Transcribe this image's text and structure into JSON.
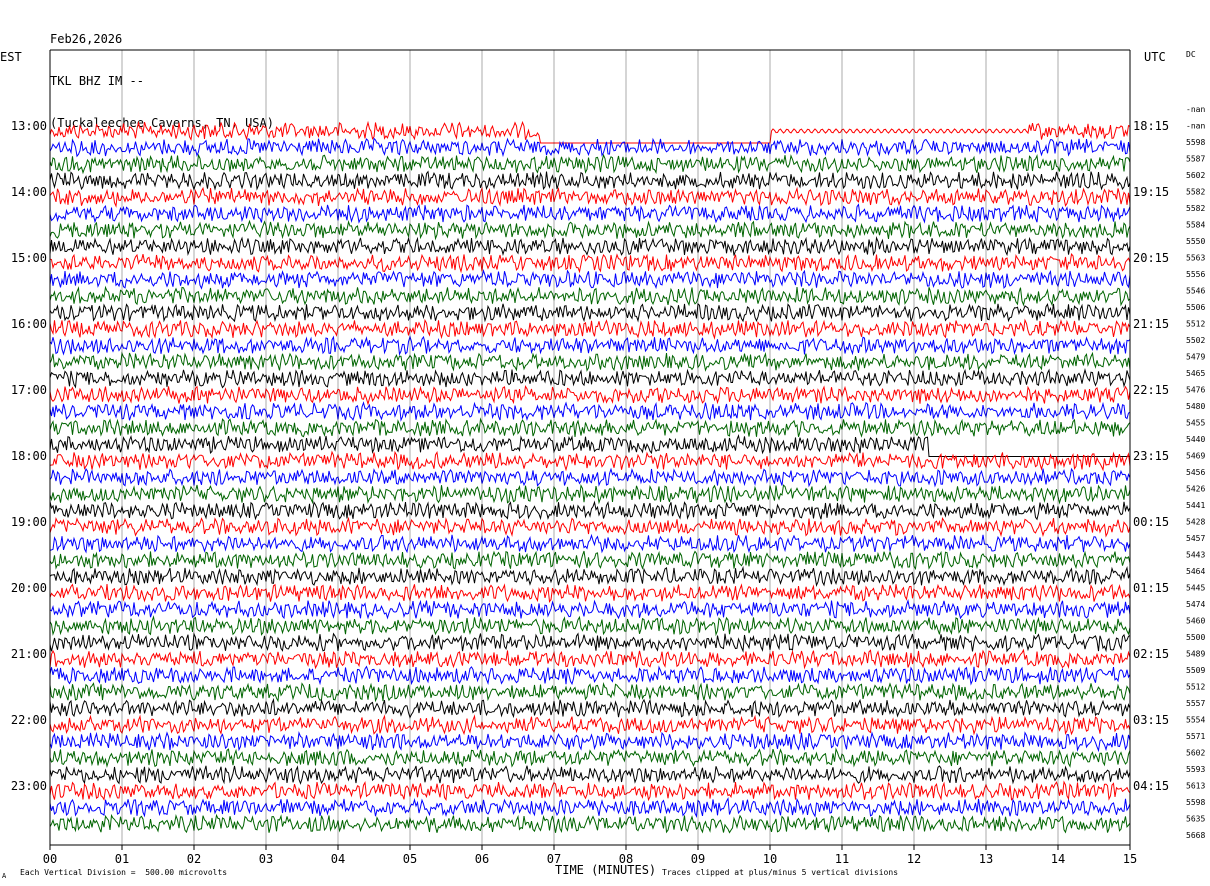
{
  "header": {
    "date": "Feb26,2026",
    "station": "TKL BHZ IM --",
    "location": "(Tuckaleechee Caverns, TN, USA)"
  },
  "left_axis_label": "EST",
  "right_axis_label": "UTC",
  "dc_label": "DC",
  "footer": {
    "x_title": "TIME (MINUTES)",
    "scale_note": "Each Vertical Division =  500.00 microvolts",
    "clip_note": "Traces clipped at plus/minus 5 vertical divisions",
    "corner_mark": "A"
  },
  "colors": {
    "trace_cycle": [
      "#ff0000",
      "#0000ff",
      "#006400",
      "#000000"
    ],
    "grid": "#000000"
  },
  "chart_data": {
    "type": "line",
    "title": "",
    "xlabel": "TIME (MINUTES)",
    "xlim": [
      0,
      15
    ],
    "x_ticks": [
      "00",
      "01",
      "02",
      "03",
      "04",
      "05",
      "06",
      "07",
      "08",
      "09",
      "10",
      "11",
      "12",
      "13",
      "14",
      "15"
    ],
    "rows_per_hour": 4,
    "left_hour_labels": [
      "13:00",
      "14:00",
      "15:00",
      "16:00",
      "17:00",
      "18:00",
      "19:00",
      "20:00",
      "21:00",
      "22:00",
      "23:00"
    ],
    "right_hour_labels": [
      "18:15",
      "19:15",
      "20:15",
      "21:15",
      "22:15",
      "23:15",
      "00:15",
      "01:15",
      "02:15",
      "03:15",
      "04:15"
    ],
    "row_values": [
      "-nan",
      "-nan",
      "5598",
      "5587",
      "5602",
      "5582",
      "5582",
      "5584",
      "5550",
      "5563",
      "5556",
      "5546",
      "5506",
      "5512",
      "5502",
      "5479",
      "5465",
      "5476",
      "5480",
      "5455",
      "5440",
      "5469",
      "5456",
      "5426",
      "5441",
      "5428",
      "5457",
      "5443",
      "5464",
      "5445",
      "5474",
      "5460",
      "5500",
      "5489",
      "5509",
      "5512",
      "5557",
      "5554",
      "5571",
      "5602",
      "5593",
      "5613",
      "5598",
      "5635",
      "5668"
    ],
    "trace_start_minute": 6.8,
    "flat_segments": [
      {
        "row": 0,
        "from": 6.8,
        "to": 10.0
      },
      {
        "row": 19,
        "from": 12.2,
        "to": 15.0
      }
    ]
  }
}
